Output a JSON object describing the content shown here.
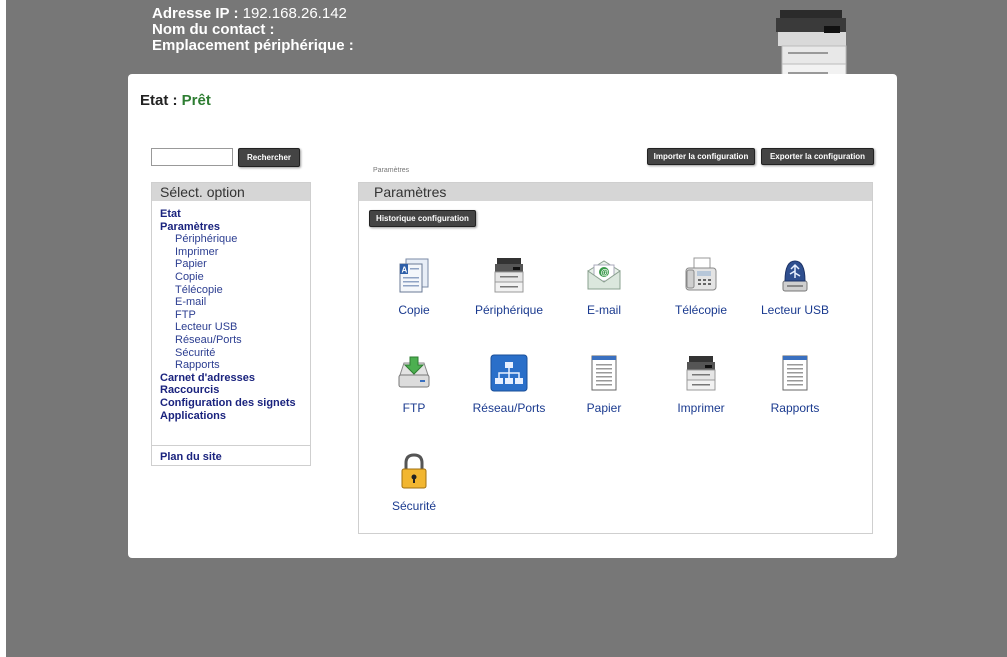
{
  "header": {
    "ip_label": "Adresse IP :",
    "ip_value": "192.168.26.142",
    "contact_label": "Nom du contact :",
    "location_label": "Emplacement périphérique :"
  },
  "status": {
    "label": "Etat :",
    "value": "Prêt"
  },
  "search": {
    "button_label": "Rechercher",
    "value": ""
  },
  "toolbar": {
    "import_label": "Importer la configuration",
    "export_label": "Exporter la configuration"
  },
  "sidebar": {
    "heading": "Sélect. option",
    "items": [
      {
        "label": "Etat",
        "level": 0
      },
      {
        "label": "Paramètres",
        "level": 0
      },
      {
        "label": "Périphérique",
        "level": 1
      },
      {
        "label": "Imprimer",
        "level": 1
      },
      {
        "label": "Papier",
        "level": 1
      },
      {
        "label": "Copie",
        "level": 1
      },
      {
        "label": "Télécopie",
        "level": 1
      },
      {
        "label": "E-mail",
        "level": 1
      },
      {
        "label": "FTP",
        "level": 1
      },
      {
        "label": "Lecteur USB",
        "level": 1
      },
      {
        "label": "Réseau/Ports",
        "level": 1
      },
      {
        "label": "Sécurité",
        "level": 1
      },
      {
        "label": "Rapports",
        "level": 1
      },
      {
        "label": "Carnet d'adresses",
        "level": 0
      },
      {
        "label": "Raccourcis",
        "level": 0
      },
      {
        "label": "Configuration des signets",
        "level": 0
      },
      {
        "label": "Applications",
        "level": 0
      }
    ],
    "sitemap_label": "Plan du site"
  },
  "main": {
    "breadcrumb": "Paramètres",
    "heading": "Paramètres",
    "history_button_label": "Historique configuration",
    "tiles": [
      {
        "label": "Copie",
        "icon": "copy-icon"
      },
      {
        "label": "Périphérique",
        "icon": "device-icon"
      },
      {
        "label": "E-mail",
        "icon": "email-icon"
      },
      {
        "label": "Télécopie",
        "icon": "fax-icon"
      },
      {
        "label": "Lecteur USB",
        "icon": "usb-drive-icon"
      },
      {
        "label": "FTP",
        "icon": "ftp-icon"
      },
      {
        "label": "Réseau/Ports",
        "icon": "network-icon"
      },
      {
        "label": "Papier",
        "icon": "paper-icon"
      },
      {
        "label": "Imprimer",
        "icon": "printer-icon"
      },
      {
        "label": "Rapports",
        "icon": "reports-icon"
      },
      {
        "label": "Sécurité",
        "icon": "lock-icon"
      }
    ]
  },
  "colors": {
    "background": "#777777",
    "button": "#444444",
    "link": "#1a237e",
    "status_ok": "#2e7d32"
  }
}
